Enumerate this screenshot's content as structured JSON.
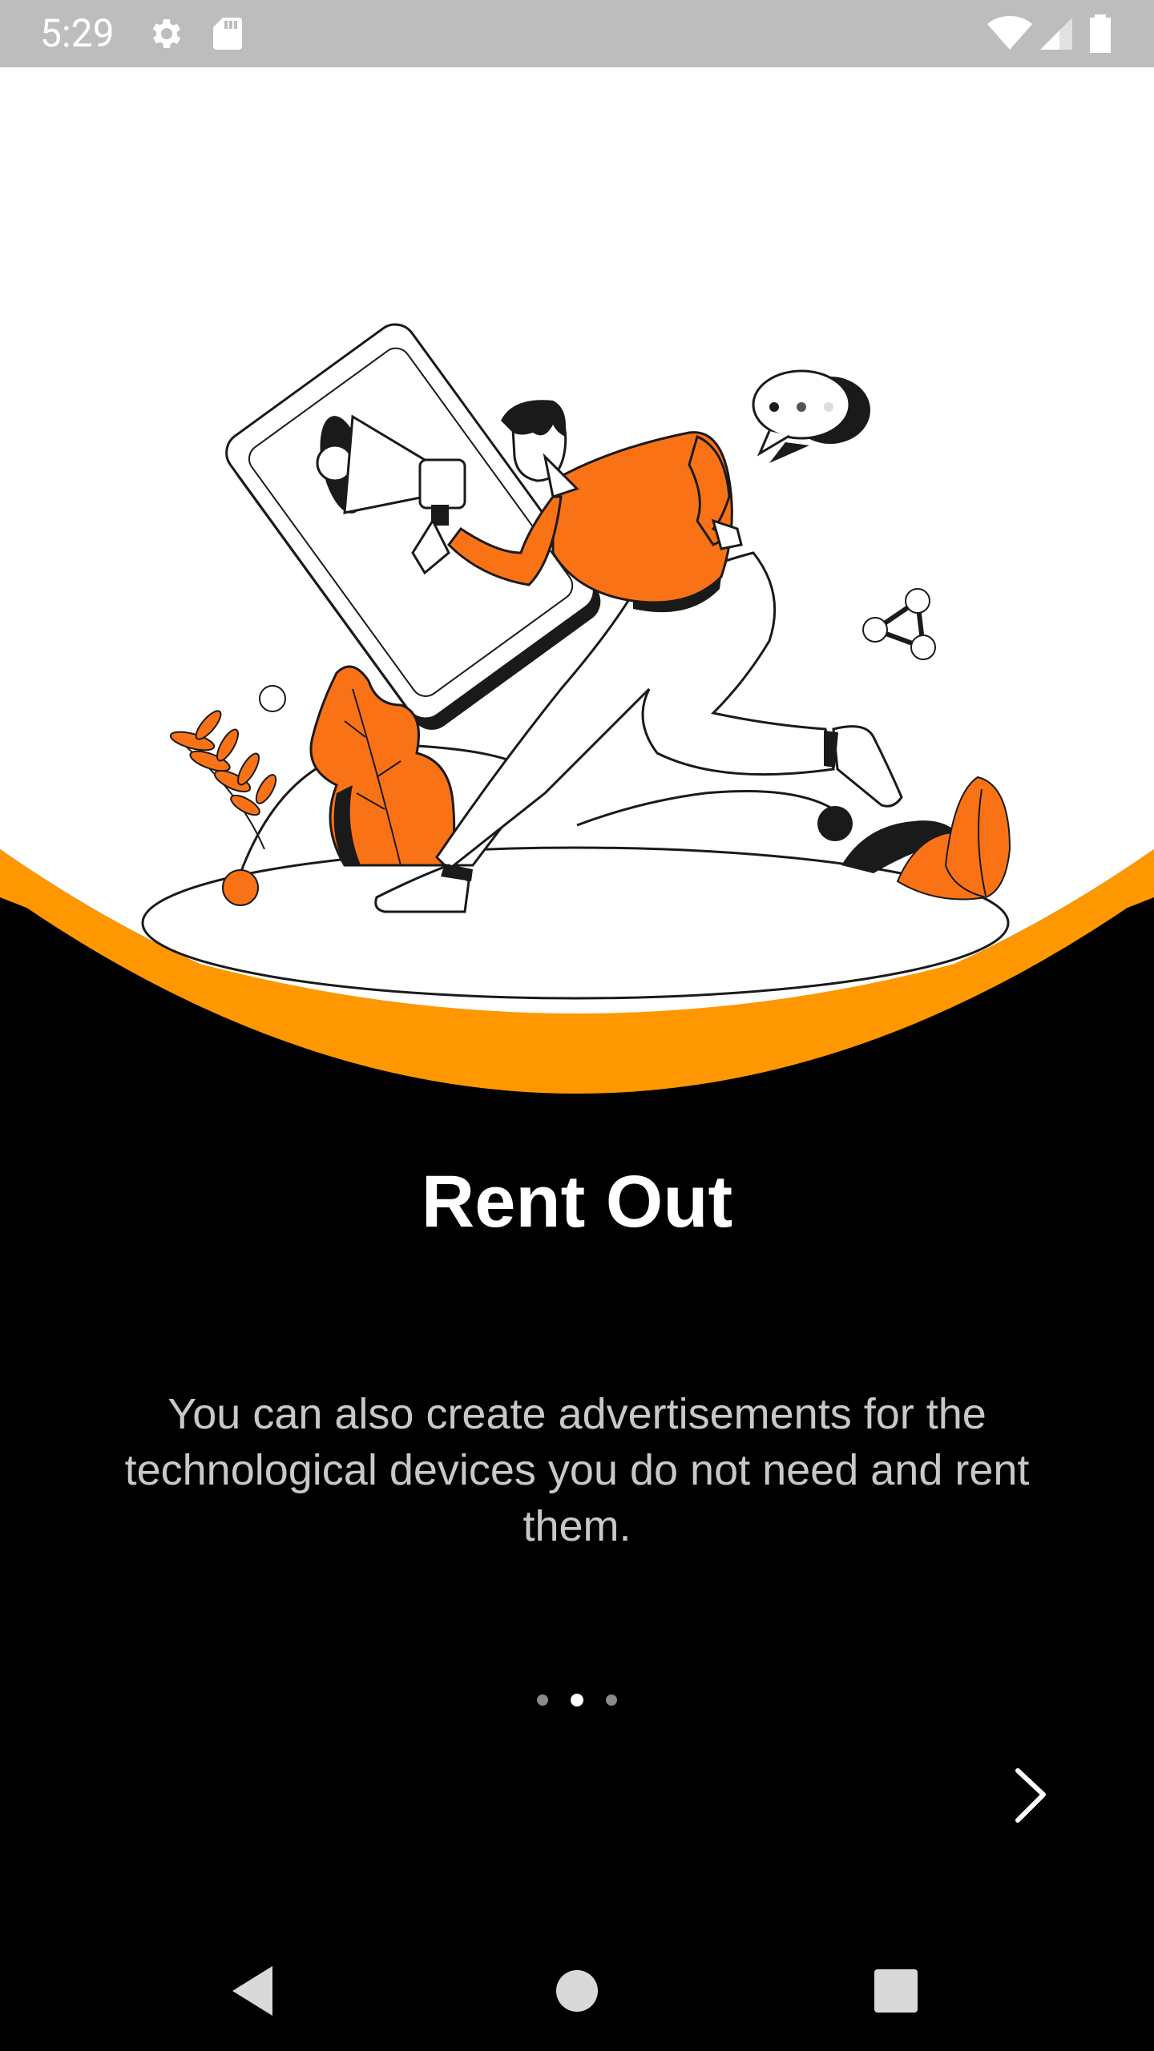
{
  "status_bar": {
    "time": "5:29",
    "icons": [
      "gear-icon",
      "sd-card-icon",
      "wifi-icon",
      "cell-signal-icon",
      "battery-icon"
    ]
  },
  "onboarding": {
    "title": "Rent Out",
    "description": "You can also create advertisements for the technological devices you do not need and rent them.",
    "page_indicator": {
      "total": 3,
      "active_index": 1
    },
    "next_icon": "chevron-right-icon"
  },
  "nav_bar": {
    "icons": [
      "back-icon",
      "home-icon",
      "recents-icon"
    ]
  },
  "colors": {
    "accent_orange": "#FF9800",
    "illustration_orange": "#F97316",
    "background": "#000000",
    "status_bar": "#BDBDBD",
    "title_text": "#FFFFFF",
    "description_text": "#C8C8C8"
  }
}
